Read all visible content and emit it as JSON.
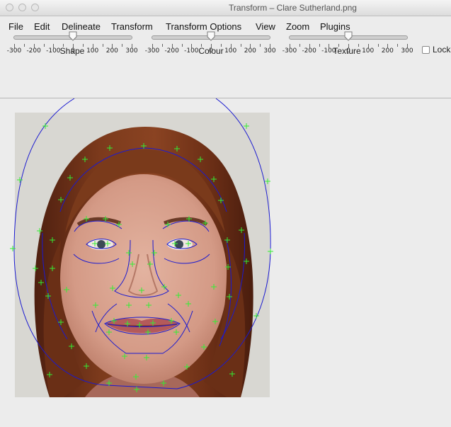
{
  "window": {
    "title": "Transform – Clare Sutherland.png"
  },
  "menu": [
    {
      "label": "File"
    },
    {
      "label": "Edit"
    },
    {
      "label": "Delineate"
    },
    {
      "label": "Transform"
    },
    {
      "label": "Transform Options"
    },
    {
      "label": "View"
    },
    {
      "label": "Zoom"
    },
    {
      "label": "Plugins"
    }
  ],
  "sliders": [
    {
      "label": "Shape",
      "value": 0,
      "min": -300,
      "max": 300,
      "tick_labels": [
        "-300",
        "-200",
        "-100",
        "0",
        "100",
        "200",
        "300"
      ]
    },
    {
      "label": "Colour",
      "value": 0,
      "min": -300,
      "max": 300,
      "tick_labels": [
        "-300",
        "-200",
        "-100",
        "0",
        "100",
        "200",
        "300"
      ]
    },
    {
      "label": "Texture",
      "value": 0,
      "min": -300,
      "max": 300,
      "tick_labels": [
        "-300",
        "-200",
        "-100",
        "0",
        "100",
        "200",
        "300"
      ]
    }
  ],
  "lock": {
    "label": "Lock",
    "checked": false
  },
  "colors": {
    "template_line": "#1a1ad0",
    "template_point": "#33ee33",
    "hair": "#7a3a1a",
    "skin": "#d9a48f"
  }
}
